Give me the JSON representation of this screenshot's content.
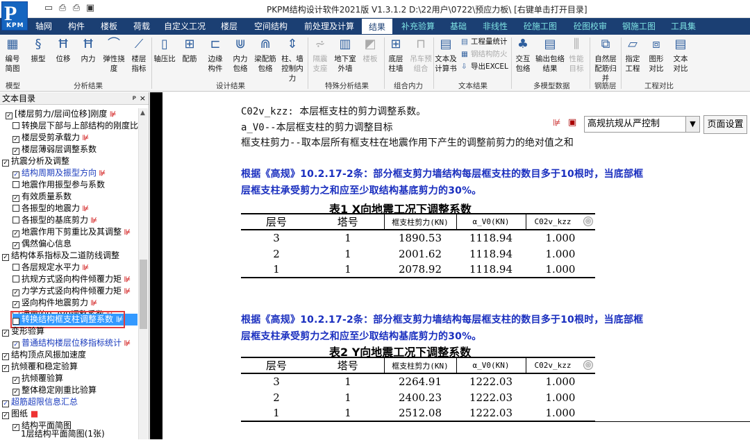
{
  "window": {
    "title": "PKPM结构设计软件2021版 V1.3.1.2 D:\\22用户\\0722\\预应力板\\ [右键单击打开目录]",
    "logo_main": "P",
    "logo_sub": "KPM"
  },
  "menu": {
    "tabs": [
      "轴网",
      "构件",
      "楼板",
      "荷载",
      "自定义工况",
      "楼层",
      "空间结构",
      "前处理及计算",
      "结果",
      "补充验算",
      "基础",
      "非线性",
      "砼施工图",
      "砼图校审",
      "钢施工图",
      "工具集"
    ],
    "active": "结果"
  },
  "ribbon": {
    "buttons": [
      "编号简图",
      "振型",
      "位移",
      "内力",
      "弹性挠度",
      "楼层指标",
      "轴压比",
      "配筋",
      "边缘构件",
      "内力包络",
      "梁配筋包络",
      "柱、墙控制内力",
      "隔震支座",
      "地下室外墙",
      "楼板",
      "底层柱墙",
      "吊车预组合",
      "文本及计算书",
      "交互包络",
      "输出包络结果",
      "性能目标",
      "自然层配筋归并",
      "指定工程",
      "图形对比",
      "文本对比"
    ],
    "small": [
      "工程量统计",
      "钢结构防火",
      "导出EXCEL"
    ],
    "groups": [
      "模型",
      "分析结果",
      "设计结果",
      "特殊分析结果",
      "组合内力",
      "文本结果",
      "多模型数据",
      "钢筋层",
      "工程对比"
    ]
  },
  "toc": {
    "title": "文本目录",
    "pin": "ᴘ",
    "close": "×",
    "items": [
      "[楼层剪力/层间位移]刚度",
      "转换层下部与上部结构的刚度比",
      "楼层受剪承载力",
      "楼层薄弱层调整系数",
      "抗震分析及调整",
      "结构周期及振型方向",
      "地震作用振型参与系数",
      "有效质量系数",
      "各振型的地震力",
      "各振型的基底剪力",
      "地震作用下剪重比及其调整",
      "偶然偏心信息",
      "结构体系指标及二道防线调整",
      "各层规定水平力",
      "抗规方式竖向构件倾覆力矩",
      "力学方式竖向构件倾覆力矩",
      "竖向构件地震剪力",
      "通用的0.2V0调整系数",
      "转换结构框支柱调整系数",
      "变形验算",
      "普通结构楼层位移指标统计",
      "结构顶点风振加速度",
      "抗倾覆和稳定验算",
      "抗倾覆验算",
      "整体稳定刚重比验算",
      "超筋超限信息汇总",
      "图纸",
      "结构平面简图",
      "1层结构平面简图(1张)"
    ]
  },
  "doc": {
    "lines": [
      "C02v_kzz:  本层框支柱的剪力调整系数。",
      "a_V0--本层框支柱的剪力调整目标",
      "框支柱剪力--取本层所有框支柱在地震作用下产生的调整前剪力的绝对值之和"
    ],
    "para1": [
      "根据《高规》10.2.17-2条：部分框支剪力墙结构每层框支柱的数目多于10根时，当底部框",
      "层框支柱承受剪力之和应至少取结构基底剪力的30%。"
    ],
    "para2": [
      "根据《高规》10.2.17-2条：部分框支剪力墙结构每层框支柱的数目多于10根时，当底部框",
      "层框支柱承受剪力之和应至少取结构基底剪力的30%。"
    ],
    "table1": {
      "title": "表1 X向地震工况下调整系数",
      "headers": [
        "层号",
        "塔号",
        "框支柱剪力(KN)",
        "α_V0(KN)",
        "C02v_kzz"
      ],
      "rows": [
        [
          "3",
          "1",
          "1890.53",
          "1118.94",
          "1.000"
        ],
        [
          "2",
          "1",
          "2001.62",
          "1118.94",
          "1.000"
        ],
        [
          "1",
          "1",
          "2078.92",
          "1118.94",
          "1.000"
        ]
      ]
    },
    "table2": {
      "title": "表2 Y向地震工况下调整系数",
      "headers": [
        "层号",
        "塔号",
        "框支柱剪力(KN)",
        "α_V0(KN)",
        "C02v_kzz"
      ],
      "rows": [
        [
          "3",
          "1",
          "2264.91",
          "1222.03",
          "1.000"
        ],
        [
          "2",
          "1",
          "2400.23",
          "1222.03",
          "1.000"
        ],
        [
          "1",
          "1",
          "2512.08",
          "1222.03",
          "1.000"
        ]
      ]
    }
  },
  "toolbar": {
    "select_value": "高规抗规从严控制",
    "page_setup": "页面设置"
  }
}
